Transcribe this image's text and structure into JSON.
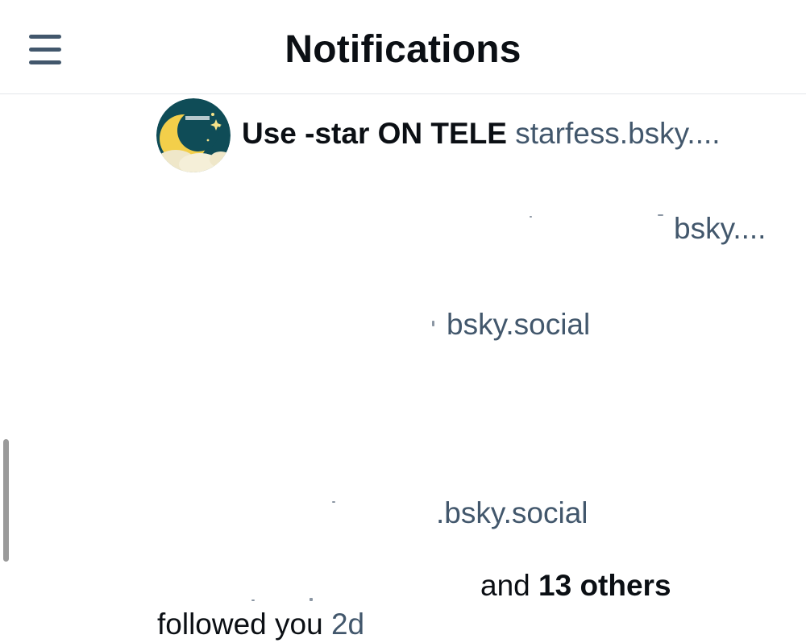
{
  "header": {
    "title": "Notifications",
    "menu_icon": "hamburger-menu-icon"
  },
  "notification": {
    "avatar_icon": "starfess-avatar-icon",
    "avatar_label": "STARFESS",
    "rows": [
      {
        "display_name": "Use -star ON TELE",
        "handle": "starfess.bsky...."
      },
      {
        "handle": "bsky...."
      },
      {
        "handle": "bsky.social"
      },
      {
        "handle": ".bsky.social"
      }
    ],
    "and_word": "and",
    "others_count": "13 others",
    "action_text": "followed you",
    "time_ago": "2d"
  },
  "colors": {
    "text_primary": "#0b0f14",
    "text_secondary": "#42576c",
    "divider": "#e3e6ea",
    "scrollbar": "#9a9a9a"
  }
}
